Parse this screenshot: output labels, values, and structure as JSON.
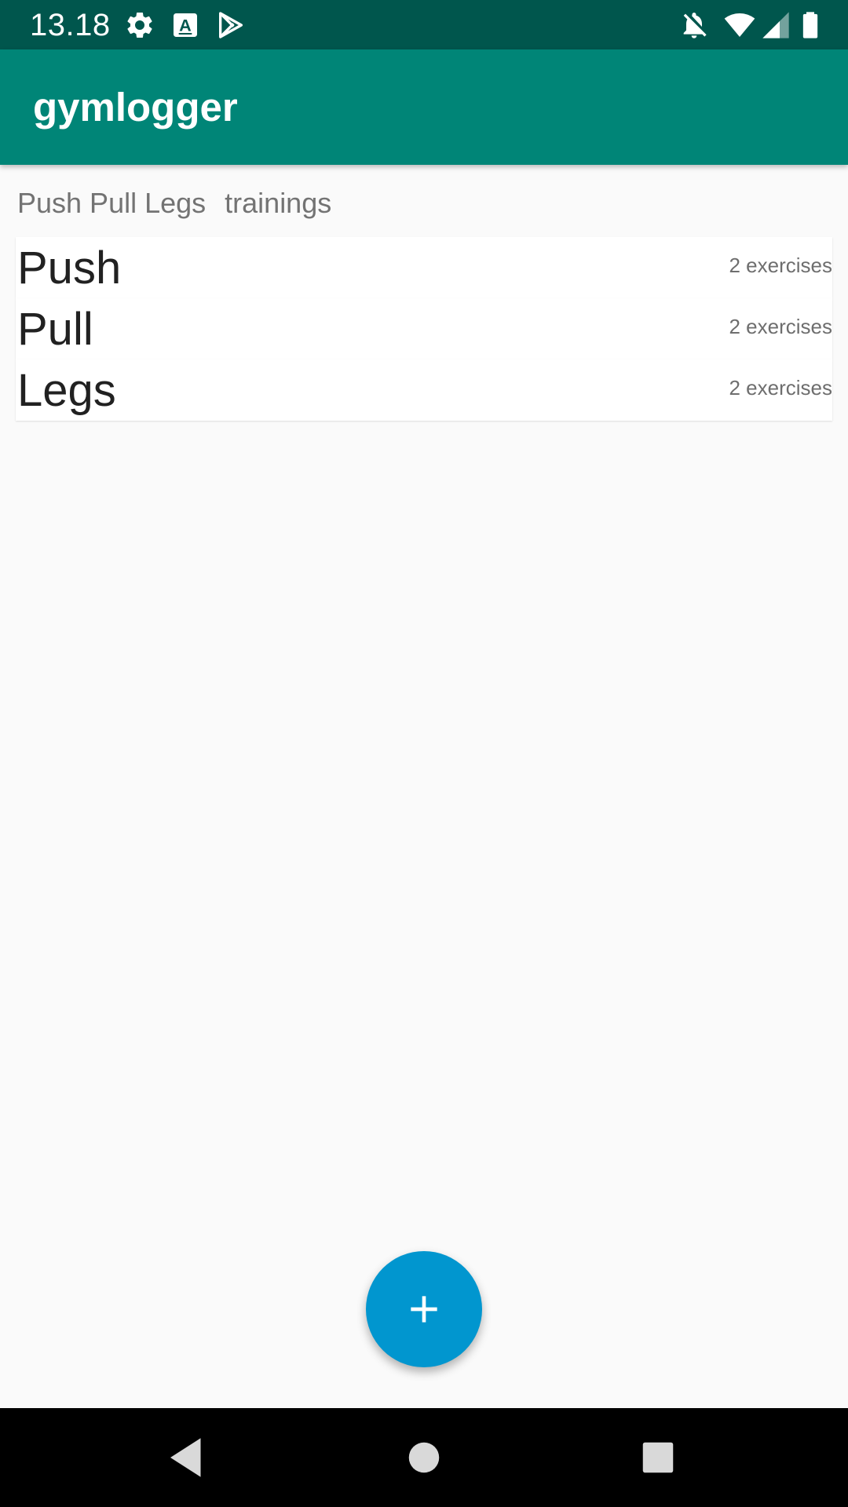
{
  "status_bar": {
    "time": "13.18",
    "left_icons": [
      "settings-icon",
      "text-a-icon",
      "play-store-icon"
    ],
    "right_icons": [
      "notifications-off-icon",
      "wifi-icon",
      "signal-icon",
      "battery-icon"
    ],
    "color": "#00564d"
  },
  "app_bar": {
    "title": "gymlogger",
    "color": "#008577"
  },
  "header": {
    "plan_name": "Push Pull Legs",
    "suffix": "trainings"
  },
  "trainings": [
    {
      "name": "Push",
      "count": "2 exercises"
    },
    {
      "name": "Pull",
      "count": "2 exercises"
    },
    {
      "name": "Legs",
      "count": "2 exercises"
    }
  ],
  "fab": {
    "icon": "plus-icon",
    "color": "#0196cf"
  },
  "nav_bar": {
    "buttons": [
      "back-icon",
      "home-icon",
      "recents-icon"
    ]
  }
}
